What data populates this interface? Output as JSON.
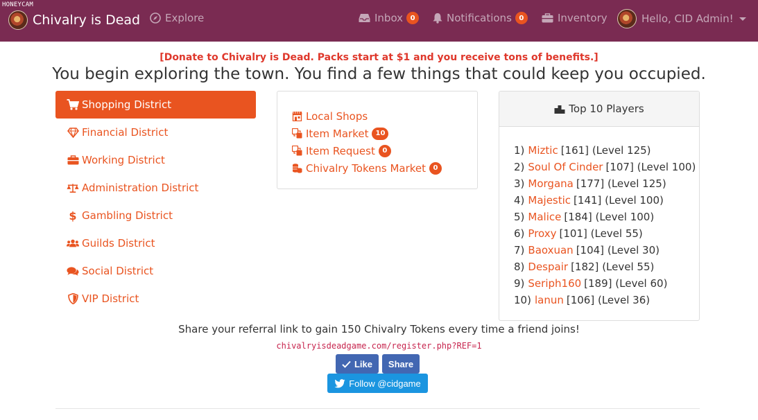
{
  "watermark": "HONEYCAM",
  "navbar": {
    "brand": "Chivalry is Dead",
    "explore": "Explore",
    "inbox": {
      "label": "Inbox",
      "count": "0"
    },
    "notifications": {
      "label": "Notifications",
      "count": "0"
    },
    "inventory": "Inventory",
    "user": "Hello, CID Admin!"
  },
  "donate_banner": "[Donate to Chivalry is Dead. Packs start at $1 and you receive tons of benefits.]",
  "headline": "You begin exploring the town. You find a few things that could keep you occupied.",
  "districts": [
    {
      "label": "Shopping District",
      "icon": "shopping-cart-icon",
      "active": true
    },
    {
      "label": "Financial District",
      "icon": "diamond-icon"
    },
    {
      "label": "Working District",
      "icon": "briefcase-icon"
    },
    {
      "label": "Administration District",
      "icon": "balance-scale-icon"
    },
    {
      "label": "Gambling District",
      "icon": "dollar-icon"
    },
    {
      "label": "Guilds District",
      "icon": "users-icon"
    },
    {
      "label": "Social District",
      "icon": "comments-icon"
    },
    {
      "label": "VIP District",
      "icon": "shield-icon"
    }
  ],
  "shop_links": [
    {
      "label": "Local Shops",
      "icon": "store-icon"
    },
    {
      "label": "Item Market",
      "badge": "10",
      "icon": "exchange-icon"
    },
    {
      "label": "Item Request",
      "badge": "0",
      "icon": "exchange-icon"
    },
    {
      "label": "Chivalry Tokens Market",
      "badge": "0",
      "icon": "coins-icon"
    }
  ],
  "top_players": {
    "title": "Top 10 Players",
    "players": [
      {
        "rank": "1)",
        "name": "Miztic",
        "id": "[161]",
        "level": "(Level 125)"
      },
      {
        "rank": "2)",
        "name": "Soul Of Cinder",
        "id": "[107]",
        "level": "(Level 100)"
      },
      {
        "rank": "3)",
        "name": "Morgana",
        "id": "[177]",
        "level": "(Level 125)"
      },
      {
        "rank": "4)",
        "name": "Majestic",
        "id": "[141]",
        "level": "(Level 100)"
      },
      {
        "rank": "5)",
        "name": "Malice",
        "id": "[184]",
        "level": "(Level 100)"
      },
      {
        "rank": "6)",
        "name": "Proxy",
        "id": "[101]",
        "level": "(Level 55)"
      },
      {
        "rank": "7)",
        "name": "Baoxuan",
        "id": "[104]",
        "level": "(Level 30)"
      },
      {
        "rank": "8)",
        "name": "Despair",
        "id": "[182]",
        "level": "(Level 55)"
      },
      {
        "rank": "9)",
        "name": "Seriph160",
        "id": "[189]",
        "level": "(Level 60)"
      },
      {
        "rank": "10)",
        "name": "lanun",
        "id": "[106]",
        "level": "(Level 36)"
      }
    ]
  },
  "referral": {
    "text": "Share your referral link to gain 150 Chivalry Tokens every time a friend joins!",
    "link": "chivalryisdeadgame.com/register.php?REF=1"
  },
  "social": {
    "like": "Like",
    "share": "Share",
    "follow": "Follow @cidgame"
  },
  "colors": {
    "navbar": "#7a2b52",
    "accent": "#e95420",
    "donate": "#df382c",
    "facebook": "#4267b2",
    "twitter": "#1b95e0"
  }
}
